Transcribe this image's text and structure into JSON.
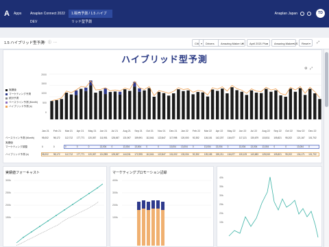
{
  "topbar": {
    "logo": "A",
    "crumbs": [
      "Apps",
      "Anaplan Connect 2022 DEV",
      "1.販売予測 / 1.5 ハイブリッド型予測"
    ],
    "user": "Anaplan Japan",
    "avatar": "TD"
  },
  "subbar": {
    "title": "1.5 ハイブリッド型予測",
    "filters": [
      "Cities",
      "Drivers",
      "Amazing Maker UK",
      "April 2021 Plus",
      "Amazing Maker US",
      "Reset"
    ]
  },
  "main_title": "ハイブリッド型予測",
  "legend": [
    {
      "label": "実績値",
      "color": "#1a1a1a"
    },
    {
      "label": "マーケティング予測",
      "color": "#2e3a8c"
    },
    {
      "label": "統計予測",
      "color": "#888888"
    },
    {
      "label": "ベースライン予測 (Month)",
      "color": "#8a6ec1"
    },
    {
      "label": "ハイブリッド予測 (s)",
      "color": "#f0a050"
    }
  ],
  "chart_data": {
    "type": "bar",
    "yticks": [
      "2000",
      "1500",
      "1000",
      "500",
      "0"
    ],
    "ylim": [
      0,
      2000
    ],
    "categories": [
      "Jan 21",
      "Feb 21",
      "Mar 21",
      "Apr 21",
      "May 21",
      "Jun 21",
      "Jul 21",
      "Aug 21",
      "Sep 21",
      "Oct 21",
      "Nov 21",
      "Dec 21",
      "Jan 22",
      "Feb 22",
      "Mar 22",
      "Apr 22",
      "May 22",
      "Jun 22",
      "Jul 22",
      "Aug 22",
      "Sep 22",
      "Oct 22",
      "Nov 22",
      "Dec 22"
    ],
    "bar_labels": [
      "Jan 21",
      "Feb 21",
      "Mar 21",
      "Apr 21",
      "May 21",
      "Jun 21",
      "Jul 21",
      "Aug 21",
      "Sep 21",
      "Oct 21",
      "Nov 21",
      "Dec 21",
      "Jan 22",
      "Feb 22",
      "Mar 22",
      "Apr 22",
      "May 22",
      "Jun 22",
      "Jul 22",
      "Aug 22",
      "Sep 22",
      "Oct 22",
      "Nov 22",
      "Dec 22"
    ],
    "series": [
      {
        "name": "実績値",
        "values": [
          810,
          850,
          900,
          1180,
          1100,
          1080,
          1350,
          1250,
          1500,
          1180,
          1260,
          1120,
          1210,
          1230,
          1100,
          1330,
          1260,
          1450,
          1220,
          1280,
          1380,
          1000,
          1210,
          1160,
          1050,
          1150,
          1330,
          1250,
          1280,
          1110,
          1210,
          1190,
          1010,
          1320,
          1260,
          1360,
          1150,
          1420,
          1290,
          1220,
          1080,
          1280,
          1180,
          1160,
          1350,
          1220,
          1280,
          1060,
          1000,
          1360,
          1220,
          1380,
          1080,
          1350,
          1150,
          900
        ]
      },
      {
        "name": "マーケティング予測",
        "values": [
          0,
          0,
          0,
          0,
          0,
          200,
          0,
          150,
          220,
          0,
          0,
          250,
          0,
          0,
          120,
          0,
          0,
          210,
          150,
          0,
          0,
          0,
          0,
          0,
          0,
          0,
          0,
          0,
          0,
          0,
          0,
          0,
          0,
          0,
          0,
          0,
          0,
          0,
          0,
          0,
          0,
          0,
          0,
          0,
          0,
          0,
          0,
          0,
          0,
          0,
          0,
          0,
          0,
          0,
          0,
          0
        ]
      },
      {
        "name": "ハイブリッド予測 (s)",
        "values": [
          830,
          870,
          950,
          1250,
          1180,
          1300,
          1450,
          1420,
          1700,
          1300,
          1320,
          1400,
          1260,
          1300,
          1260,
          1380,
          1320,
          1680,
          1400,
          1320,
          1450,
          1050,
          1270,
          1220,
          1150,
          1240,
          1400,
          1320,
          1350,
          1200,
          1280,
          1250,
          1080,
          1400,
          1330,
          1440,
          1250,
          1500,
          1360,
          1290,
          1150,
          1350,
          1250,
          1230,
          1420,
          1300,
          1350,
          1140,
          1080,
          1420,
          1300,
          1450,
          1150,
          1420,
          1220,
          960
        ]
      }
    ]
  },
  "table": {
    "headers": [
      "Jan 21",
      "Feb 21",
      "Mar 21",
      "Apr 21",
      "May 21",
      "Jun 21",
      "Jul 21",
      "Aug 21",
      "Sep 21",
      "Oct 21",
      "Nov 21",
      "Dec 21",
      "Jan 22",
      "Feb 22",
      "Mar 22",
      "Apr 22",
      "May 22",
      "Jun 22",
      "Jul 22",
      "Aug 22",
      "Sep 22",
      "Oct 22",
      "Nov 22",
      "Dec 22"
    ],
    "rows": [
      {
        "label": "ベースライン予測 (Month)",
        "cells": [
          "95,002",
          "98,172",
          "112,712",
          "177,771",
          "120,057",
          "111,951",
          "128,067",
          "131,907",
          "159,991",
          "112,841",
          "122,847",
          "117,998",
          "120,000",
          "92,352",
          "126,181",
          "142,207",
          "116,677",
          "117,121",
          "130,679",
          "115,511",
          "105,821",
          "95,202",
          "121,167",
          "101,702"
        ]
      },
      {
        "label": "実績値",
        "cells": []
      },
      {
        "label": "マーケティング調整",
        "cells": [
          "0",
          "0",
          "0",
          "0",
          "0",
          "13,004",
          "0",
          "13,004",
          "13,004",
          "0",
          "0",
          "13,004",
          "13,004",
          "0",
          "13,004",
          "13,004",
          "0",
          "13,004",
          "13,004",
          "13,004",
          "0",
          "0",
          "13,004",
          "0"
        ]
      },
      {
        "label": "ハイブリッド予測 (s)",
        "cells": [
          "98,002",
          "98,172",
          "112,712",
          "177,771",
          "120,057",
          "124,955",
          "128,067",
          "144,911",
          "172,995",
          "112,841",
          "122,847",
          "131,002",
          "133,004",
          "92,352",
          "139,185",
          "155,211",
          "116,677",
          "130,125",
          "143,683",
          "128,515",
          "105,821",
          "95,202",
          "134,171",
          "101,702"
        ]
      }
    ]
  },
  "card1": {
    "title": "実績値フォーキャスト",
    "yticks": [
      "300k",
      "250k",
      "200k",
      "150k"
    ]
  },
  "card2": {
    "title": "マーケティングプロモーション記録",
    "yticks": [
      "400k",
      "300k",
      "200k",
      "100k"
    ]
  },
  "card3": {
    "yticks": [
      "40k",
      "35k",
      "30k",
      "25k",
      "20k",
      "15k"
    ]
  }
}
